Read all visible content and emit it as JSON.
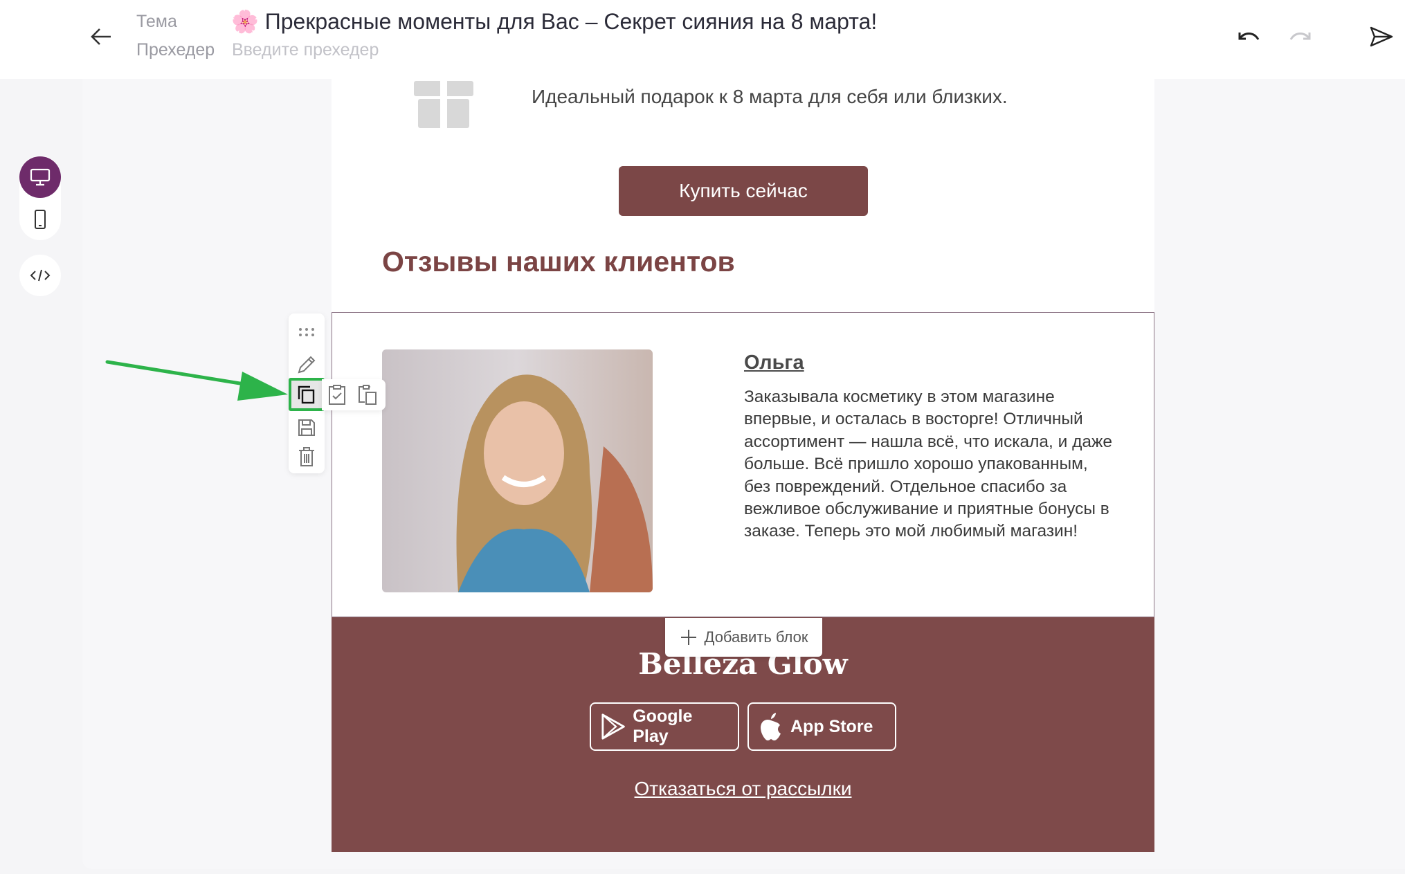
{
  "header": {
    "subject_label": "Тема",
    "subject_emoji": "🌸",
    "subject_value": "Прекрасные моменты для Вас – Секрет сияния на 8 марта!",
    "preheader_label": "Прехедер",
    "preheader_placeholder": "Введите прехедер"
  },
  "sidebar": {
    "views": [
      "desktop-icon",
      "mobile-icon",
      "code-icon"
    ],
    "active": "desktop",
    "accent": "#6e2b6a"
  },
  "email": {
    "gift_text": "Идеальный подарок к 8 марта для себя или близких.",
    "buy_button": "Купить сейчас",
    "reviews_heading": "Отзывы наших клиентов",
    "review": {
      "name": "Ольга ",
      "text": "Заказывала косметику в этом магазине впервые, и осталась в восторге! Отличный ассортимент — нашла всё, что искала, и даже больше. Всё пришло хорошо упакованным, без повреждений. Отдельное спасибо за вежливое обслуживание и приятные бонусы в заказе. Теперь это мой любимый магазин!"
    },
    "add_block": "Добавить блок",
    "brand": "Belleza Glow",
    "google_play": "Google Play",
    "app_store": "App Store",
    "unsubscribe": "Отказаться от рассылки",
    "footer_color": "#7e4a4a"
  },
  "block_toolbar": {
    "items": [
      "drag-icon",
      "edit-icon",
      "copy-icon",
      "save-icon",
      "delete-icon"
    ],
    "highlighted": "copy-icon",
    "submenu": [
      "copy-style-icon",
      "paste-icon"
    ],
    "highlight_color": "#2db34a"
  }
}
